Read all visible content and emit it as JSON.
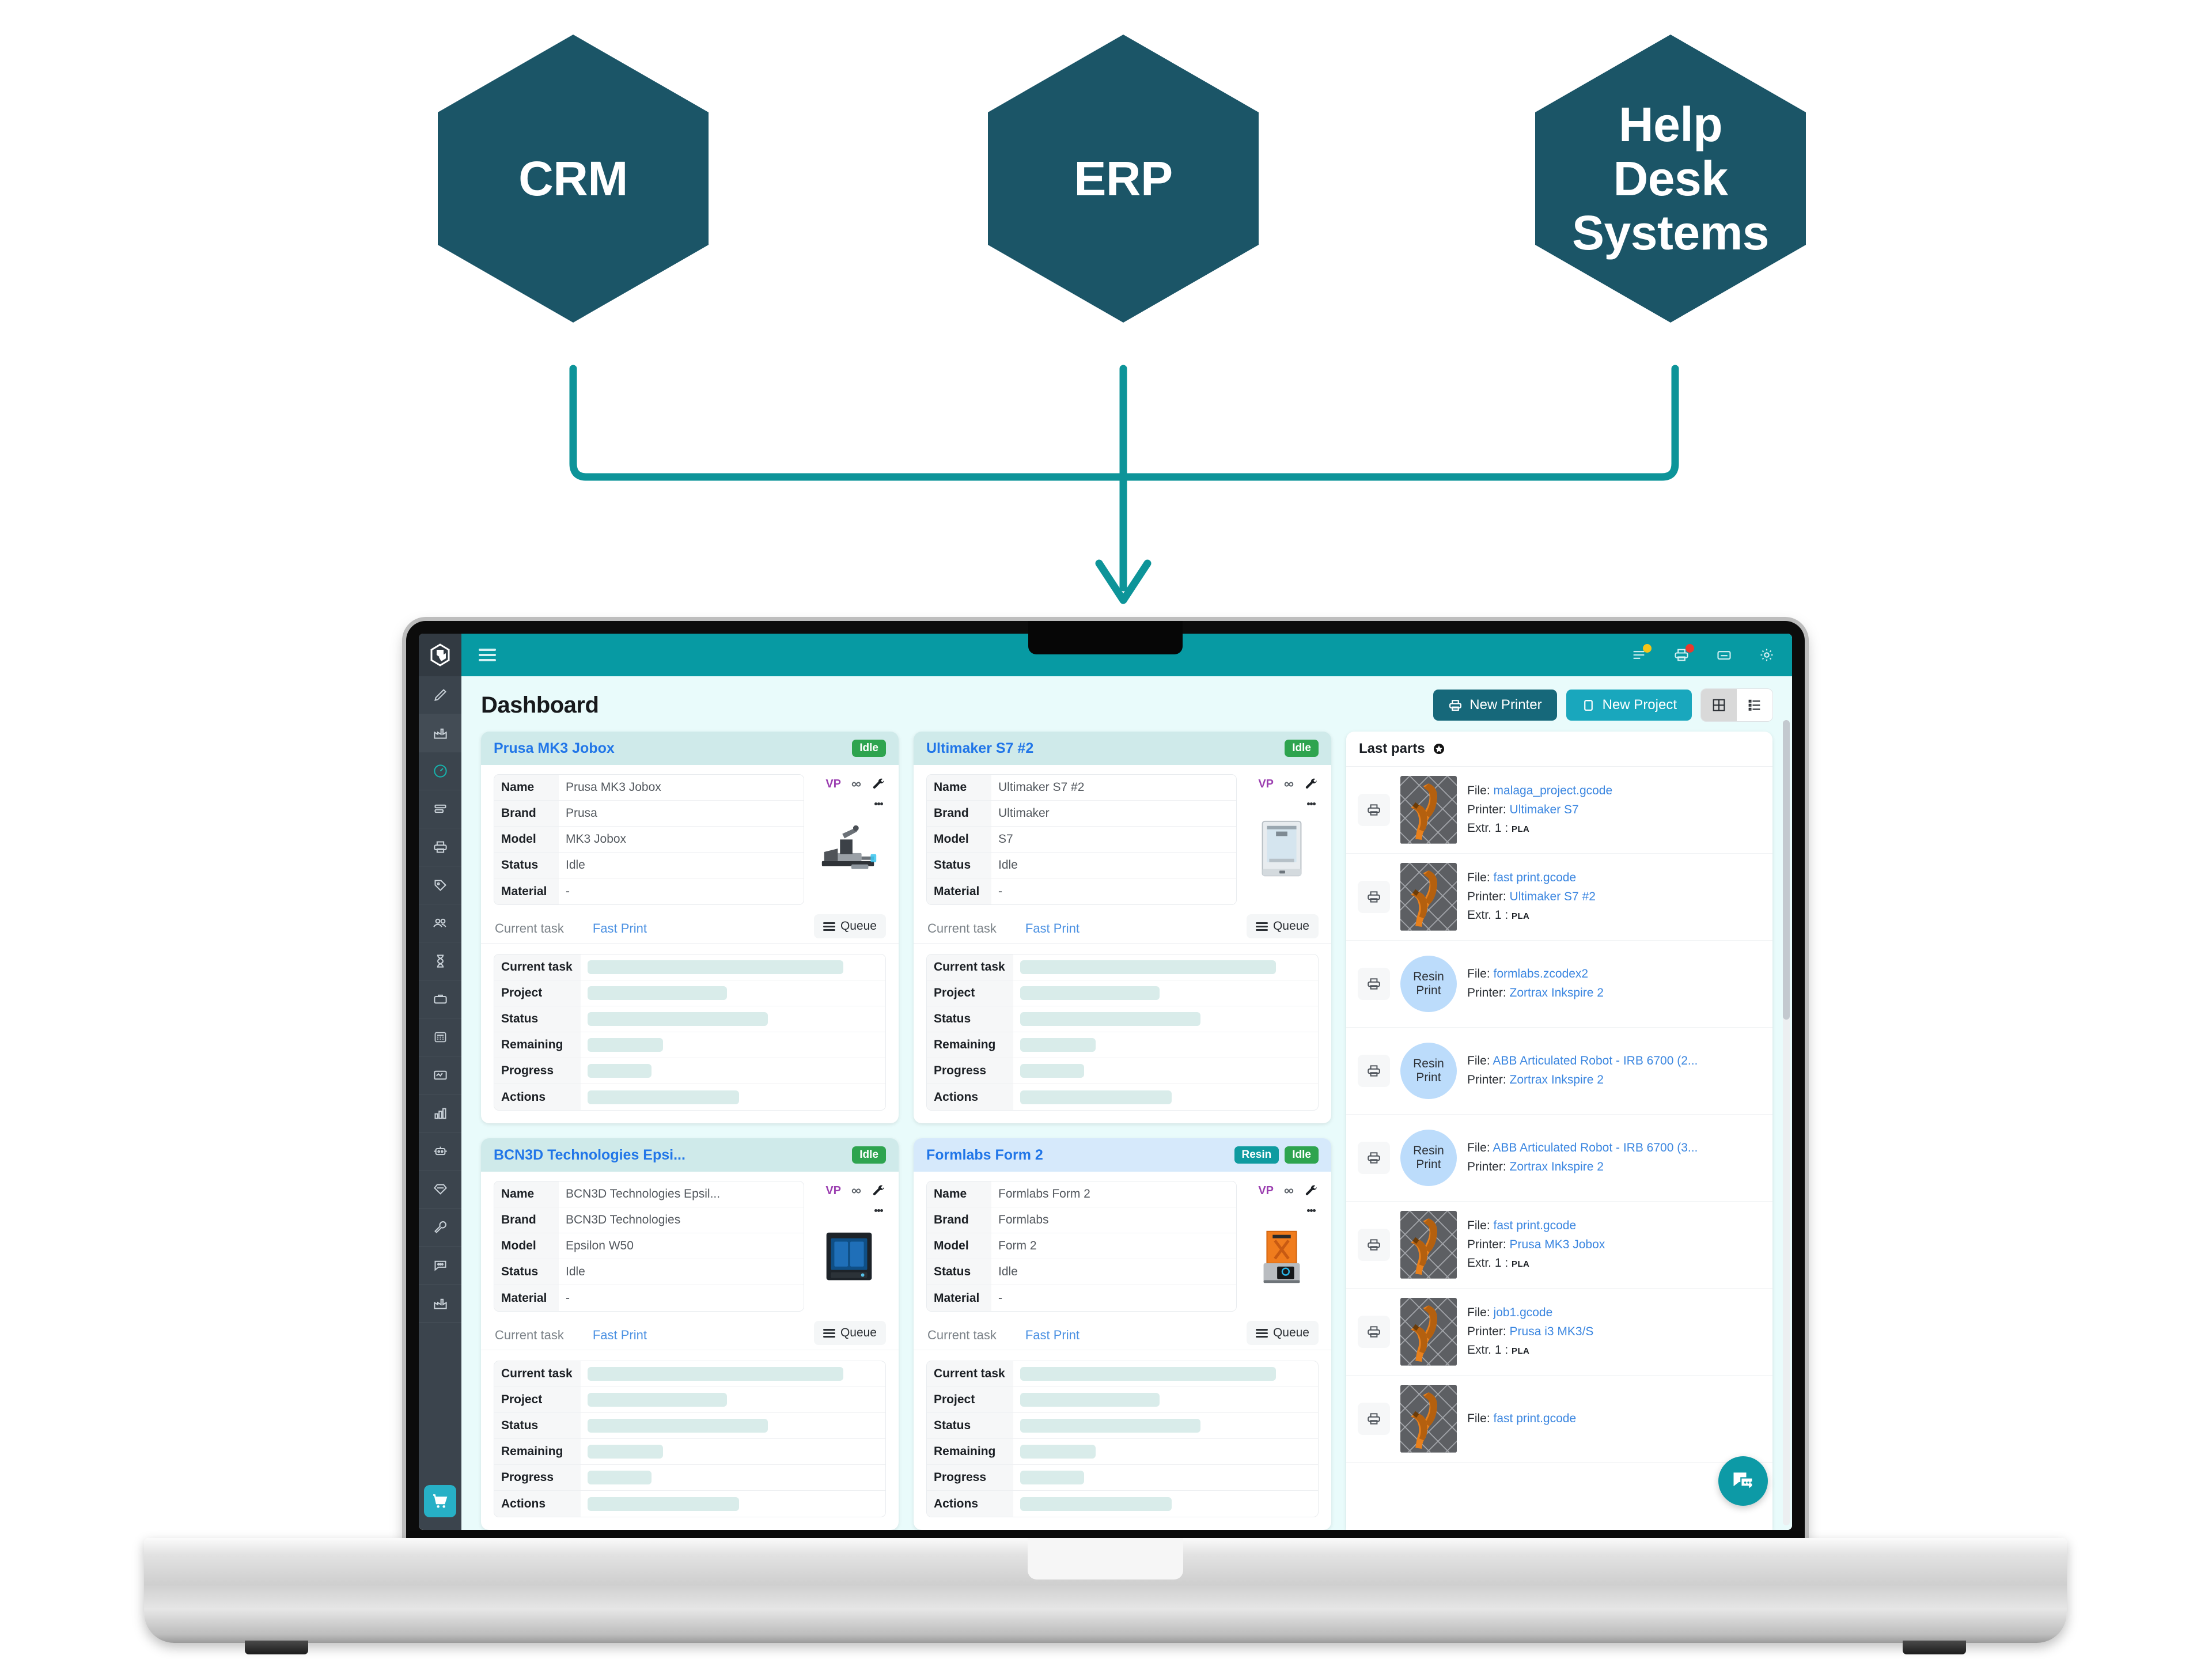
{
  "diagram": {
    "nodes": [
      {
        "label": "CRM",
        "icon": "hexagon-shape"
      },
      {
        "label": "ERP",
        "icon": "hexagon-shape"
      },
      {
        "label": "Help\nDesk\nSystems",
        "icon": "hexagon-shape"
      }
    ],
    "connector_color": "#0d9499",
    "node_color": "#1b5567"
  },
  "app": {
    "topbar": {
      "menu_icon": "hamburger-icon",
      "icons": [
        {
          "name": "queue-list-icon",
          "dot": "#f5c518"
        },
        {
          "name": "printer-icon",
          "dot": "#e8392e"
        },
        {
          "name": "drawer-icon",
          "dot": ""
        },
        {
          "name": "gear-icon",
          "dot": ""
        }
      ]
    },
    "sidebar": {
      "logo": "app-logo",
      "cart_label": "cart-icon",
      "items": [
        {
          "name": "sidebar-item-design",
          "icon": "pencil-icon",
          "active": false
        },
        {
          "name": "sidebar-item-factory",
          "icon": "factory-icon",
          "active": true
        },
        {
          "name": "sidebar-item-dashboard",
          "icon": "speedometer-icon",
          "active": false
        },
        {
          "name": "sidebar-item-queue",
          "icon": "queue-icon",
          "active": false
        },
        {
          "name": "sidebar-item-printers",
          "icon": "printer-icon",
          "active": false
        },
        {
          "name": "sidebar-item-materials",
          "icon": "tag-icon",
          "active": false
        },
        {
          "name": "sidebar-item-users",
          "icon": "users-icon",
          "active": false
        },
        {
          "name": "sidebar-item-jobs",
          "icon": "hourglass-icon",
          "active": false
        },
        {
          "name": "sidebar-item-projects",
          "icon": "briefcase-icon",
          "active": false
        },
        {
          "name": "sidebar-item-costs",
          "icon": "calculator-icon",
          "active": false
        },
        {
          "name": "sidebar-item-monitor",
          "icon": "monitor-chart-icon",
          "active": false
        },
        {
          "name": "sidebar-item-reports",
          "icon": "bar-chart-icon",
          "active": false
        },
        {
          "name": "sidebar-item-robots",
          "icon": "robot-icon",
          "active": false
        },
        {
          "name": "sidebar-item-quality",
          "icon": "diamond-icon",
          "active": false
        },
        {
          "name": "sidebar-item-maintenance",
          "icon": "wrench-icon",
          "active": false
        },
        {
          "name": "sidebar-item-messages",
          "icon": "chat-icon",
          "active": false
        },
        {
          "name": "sidebar-item-plant",
          "icon": "factory-icon",
          "active": false
        }
      ]
    },
    "page": {
      "title": "Dashboard",
      "new_printer_label": "New Printer",
      "new_project_label": "New Project",
      "view_grid_icon": "grid-view-icon",
      "view_list_icon": "list-view-icon"
    },
    "spec_labels": [
      "Name",
      "Brand",
      "Model",
      "Status",
      "Material"
    ],
    "task_labels": [
      "Current task",
      "Project",
      "Status",
      "Remaining",
      "Progress",
      "Actions"
    ],
    "task_skeleton_widths": [
      "88%",
      "48%",
      "62%",
      "26%",
      "22%",
      "52%"
    ],
    "tabs": {
      "current_task": "Current task",
      "fast_print": "Fast Print",
      "queue": "Queue"
    },
    "side_icons": {
      "vp": "VP",
      "infinity": "infinity-icon",
      "wrench": "wrench-icon",
      "kebab": "more-vertical-icon"
    },
    "printers": [
      {
        "title": "Prusa MK3 Jobox",
        "badges": [
          {
            "text": "Idle",
            "kind": "idle"
          }
        ],
        "header_tone": "teal",
        "image": "prusa-mk3-printer",
        "specs": {
          "Name": "Prusa MK3 Jobox",
          "Brand": "Prusa",
          "Model": "MK3 Jobox",
          "Status": "Idle",
          "Material": "-"
        }
      },
      {
        "title": "Ultimaker S7 #2",
        "badges": [
          {
            "text": "Idle",
            "kind": "idle"
          }
        ],
        "header_tone": "teal",
        "image": "ultimaker-s7-printer",
        "specs": {
          "Name": "Ultimaker S7 #2",
          "Brand": "Ultimaker",
          "Model": "S7",
          "Status": "Idle",
          "Material": "-"
        }
      },
      {
        "title": "BCN3D Technologies Epsi...",
        "badges": [
          {
            "text": "Idle",
            "kind": "idle"
          }
        ],
        "header_tone": "teal",
        "image": "bcn3d-epsilon-printer",
        "specs": {
          "Name": "BCN3D Technologies Epsil...",
          "Brand": "BCN3D Technologies",
          "Model": "Epsilon W50",
          "Status": "Idle",
          "Material": "-"
        }
      },
      {
        "title": "Formlabs Form 2",
        "badges": [
          {
            "text": "Resin",
            "kind": "resin"
          },
          {
            "text": "Idle",
            "kind": "idle"
          }
        ],
        "header_tone": "blue",
        "image": "formlabs-form2-printer",
        "specs": {
          "Name": "Formlabs Form 2",
          "Brand": "Formlabs",
          "Model": "Form 2",
          "Status": "Idle",
          "Material": "-"
        }
      }
    ],
    "last_parts": {
      "title": "Last parts",
      "title_icon": "star-badge-icon",
      "labels": {
        "file": "File:",
        "printer": "Printer:",
        "extruder": "Extr. 1 :"
      },
      "items": [
        {
          "thumb": "gcode-preview",
          "file": "malaga_project.gcode",
          "printer": "Ultimaker S7",
          "extruder": "PLA"
        },
        {
          "thumb": "gcode-preview",
          "file": "fast print.gcode",
          "printer": "Ultimaker S7 #2",
          "extruder": "PLA"
        },
        {
          "thumb": "resin-print",
          "thumb_text": "Resin\nPrint",
          "file": "formlabs.zcodex2",
          "printer": "Zortrax Inkspire 2",
          "extruder": ""
        },
        {
          "thumb": "resin-print",
          "thumb_text": "Resin\nPrint",
          "file": "ABB Articulated Robot - IRB 6700 (2...",
          "printer": "Zortrax Inkspire 2",
          "extruder": ""
        },
        {
          "thumb": "resin-print",
          "thumb_text": "Resin\nPrint",
          "file": "ABB Articulated Robot - IRB 6700 (3...",
          "printer": "Zortrax Inkspire 2",
          "extruder": ""
        },
        {
          "thumb": "gcode-preview",
          "file": "fast print.gcode",
          "printer": "Prusa MK3 Jobox",
          "extruder": "PLA"
        },
        {
          "thumb": "gcode-preview",
          "file": "job1.gcode",
          "printer": "Prusa i3 MK3/S",
          "extruder": "PLA"
        },
        {
          "thumb": "gcode-preview",
          "file": "fast print.gcode",
          "printer": "",
          "extruder": ""
        }
      ]
    },
    "chat_fab_icon": "chat-bubbles-icon"
  }
}
